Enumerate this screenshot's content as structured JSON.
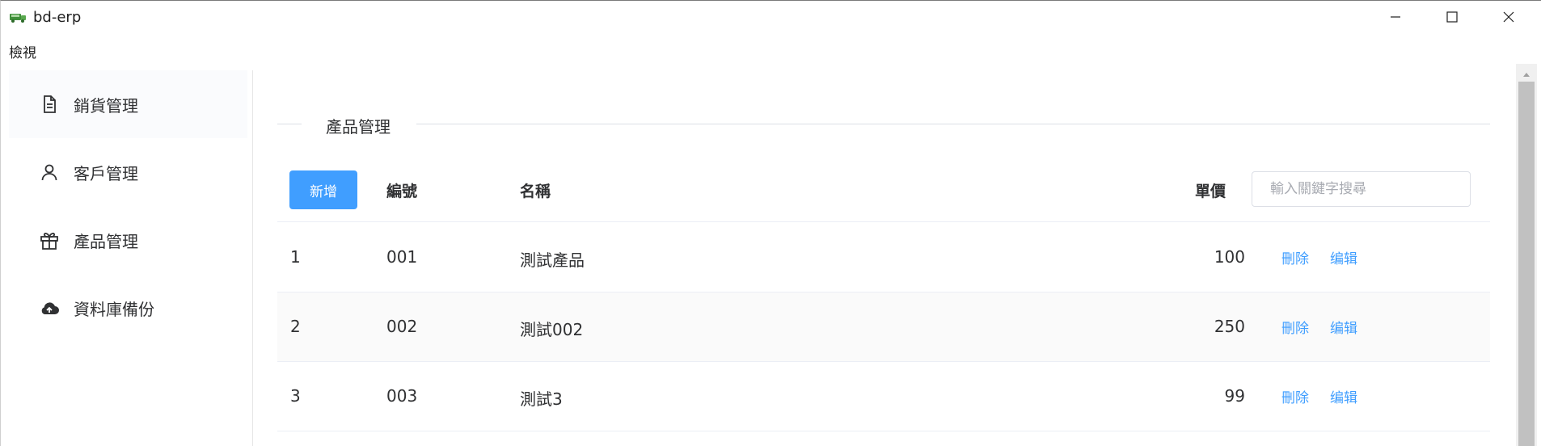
{
  "window": {
    "title": "bd-erp",
    "icons": [
      "app-icon",
      "minimize-icon",
      "maximize-icon",
      "close-icon"
    ]
  },
  "menu": {
    "view": "檢視"
  },
  "sidebar": {
    "items": [
      {
        "label": "銷貨管理",
        "icon": "document-icon",
        "active": true
      },
      {
        "label": "客戶管理",
        "icon": "user-icon",
        "active": false
      },
      {
        "label": "產品管理",
        "icon": "gift-icon",
        "active": false
      },
      {
        "label": "資料庫備份",
        "icon": "cloud-upload-icon",
        "active": false
      }
    ]
  },
  "main": {
    "section_title": "產品管理",
    "add_button": "新增",
    "columns": {
      "code": "編號",
      "name": "名稱",
      "price": "單價"
    },
    "search": {
      "placeholder": "輸入關鍵字搜尋",
      "value": ""
    },
    "rows": [
      {
        "idx": "1",
        "code": "001",
        "name": "測試產品",
        "price": "100",
        "delete": "刪除",
        "edit": "编辑"
      },
      {
        "idx": "2",
        "code": "002",
        "name": "測試002",
        "price": "250",
        "delete": "刪除",
        "edit": "编辑"
      },
      {
        "idx": "3",
        "code": "003",
        "name": "測試3",
        "price": "99",
        "delete": "刪除",
        "edit": "编辑"
      }
    ]
  },
  "colors": {
    "primary": "#409eff",
    "text": "#303133",
    "placeholder": "#a8abb2",
    "border": "#dcdfe6",
    "stripe": "#fafafa",
    "scroll_thumb": "#c1c1c1"
  }
}
